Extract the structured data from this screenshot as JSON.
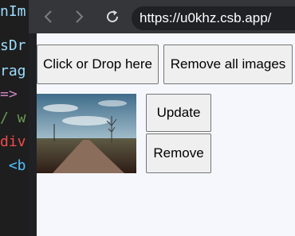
{
  "editor": {
    "lines": [
      {
        "text": "nIm",
        "color": "#9cdcfe"
      },
      {
        "text": "sDr",
        "color": "#9cdcfe"
      },
      {
        "text": "rag",
        "color": "#9cdcfe"
      },
      {
        "text": "=>",
        "color": "#c586c0"
      },
      {
        "text": "/ w",
        "color": "#6a9955"
      },
      {
        "text": "div",
        "color": "#f14c4c"
      },
      {
        "text": " <b",
        "color": "#4fc1ff"
      }
    ]
  },
  "browser": {
    "url": "https://u0khz.csb.app/",
    "icons": {
      "back": "arrow-left-icon",
      "forward": "arrow-right-icon",
      "reload": "reload-icon"
    }
  },
  "app": {
    "upload_label": "Click or Drop here",
    "remove_all_label": "Remove all images",
    "images": [
      {
        "update_label": "Update",
        "remove_label": "Remove"
      }
    ]
  }
}
